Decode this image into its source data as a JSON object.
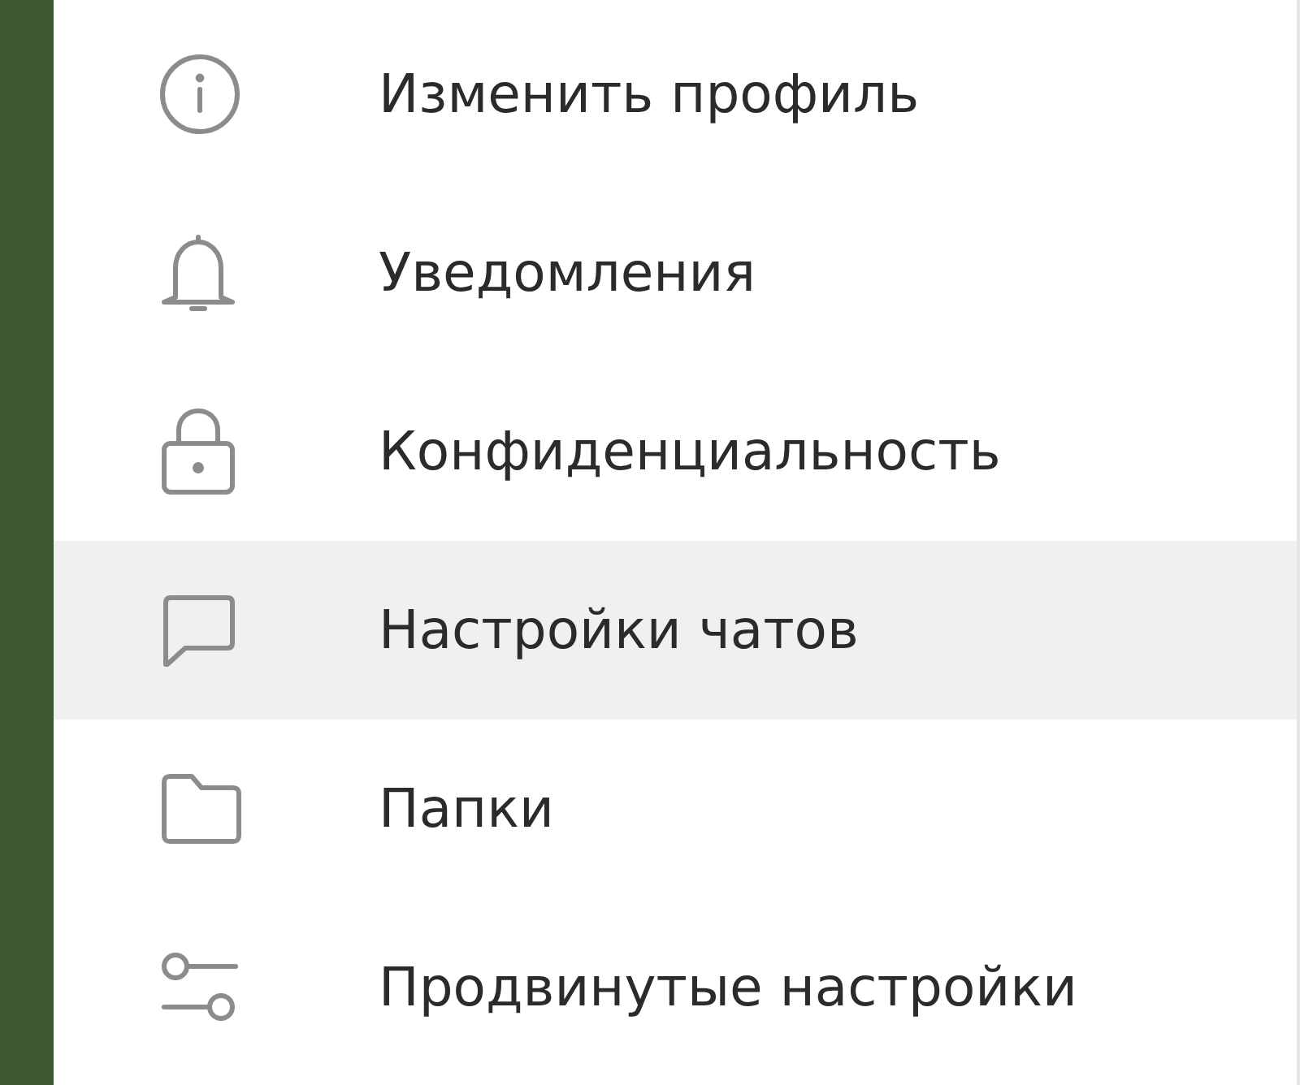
{
  "menu": {
    "items": [
      {
        "label": "Изменить профиль",
        "selected": false
      },
      {
        "label": "Уведомления",
        "selected": false
      },
      {
        "label": "Конфиденциальность",
        "selected": false
      },
      {
        "label": "Настройки чатов",
        "selected": true
      },
      {
        "label": "Папки",
        "selected": false
      },
      {
        "label": "Продвинутые настройки",
        "selected": false
      }
    ]
  }
}
